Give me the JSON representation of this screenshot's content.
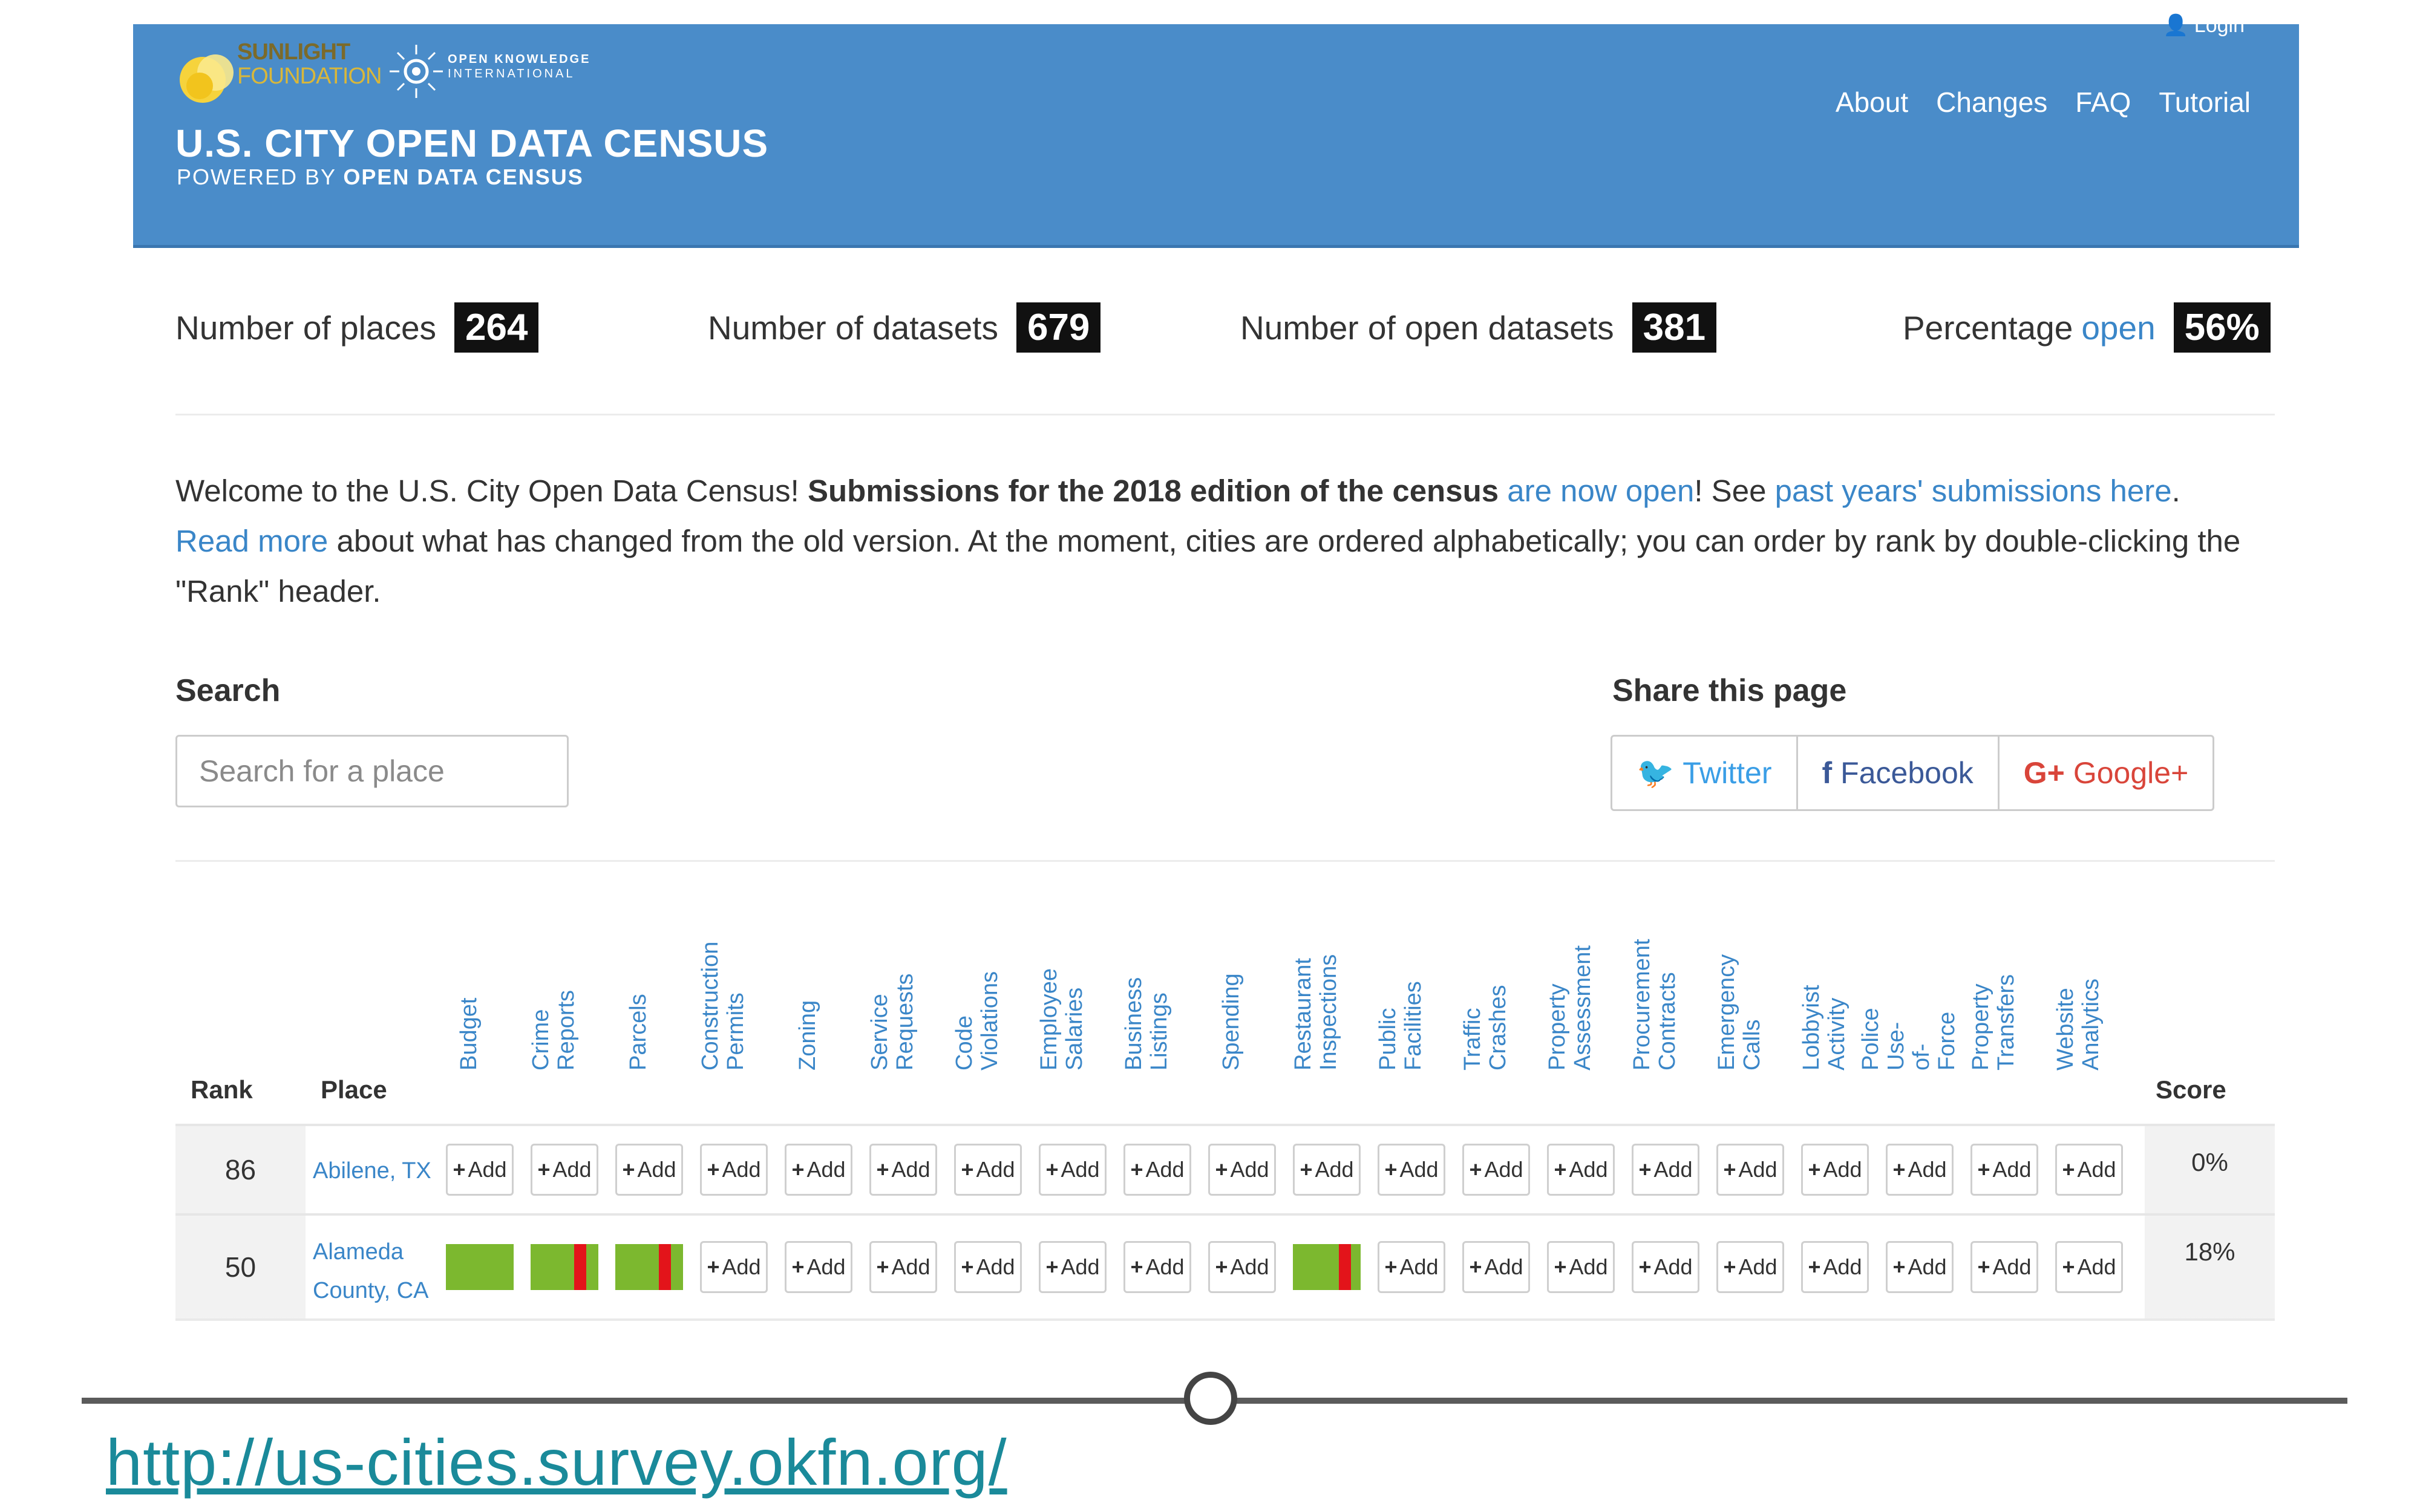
{
  "header": {
    "logo_sunlight_line1": "SUNLIGHT",
    "logo_sunlight_line2": "FOUNDATION",
    "logo_oki_line1": "OPEN KNOWLEDGE",
    "logo_oki_line2": "INTERNATIONAL",
    "title": "U.S. CITY OPEN DATA CENSUS",
    "subtitle_prefix": "POWERED BY",
    "subtitle_brand": "OPEN DATA CENSUS",
    "login": "Login",
    "nav": [
      "About",
      "Changes",
      "FAQ",
      "Tutorial"
    ],
    "color": "#4a8cc9"
  },
  "stats": [
    {
      "label": "Number of places",
      "value": "264"
    },
    {
      "label": "Number of datasets",
      "value": "679"
    },
    {
      "label": "Number of open datasets",
      "value": "381"
    },
    {
      "label": "Percentage",
      "label_link": "open",
      "value": "56%"
    }
  ],
  "welcome": {
    "t1": "Welcome to the U.S. City Open Data Census! ",
    "bold": "Submissions for the 2018 edition of the census ",
    "link1": "are now open",
    "t2": "! See ",
    "link2": "past years' submissions here",
    "t3": ".",
    "link3": "Read more",
    "t4": " about what has changed from the old version. At the moment, cities are ordered alphabetically; you can order by rank by double-clicking the \"Rank\" header."
  },
  "search": {
    "label": "Search",
    "placeholder": "Search for a place"
  },
  "share": {
    "label": "Share this page",
    "twitter": "Twitter",
    "facebook": "Facebook",
    "google": "Google+"
  },
  "table": {
    "rank_header": "Rank",
    "place_header": "Place",
    "score_header": "Score",
    "add_label": "Add",
    "columns": [
      [
        "Budget"
      ],
      [
        "Crime",
        "Reports"
      ],
      [
        "Parcels"
      ],
      [
        "Construction",
        "Permits"
      ],
      [
        "Zoning"
      ],
      [
        "Service",
        "Requests"
      ],
      [
        "Code",
        "Violations"
      ],
      [
        "Employee",
        "Salaries"
      ],
      [
        "Business",
        "Listings"
      ],
      [
        "Spending"
      ],
      [
        "Restaurant",
        "Inspections"
      ],
      [
        "Public",
        "Facilities"
      ],
      [
        "Traffic",
        "Crashes"
      ],
      [
        "Property",
        "Assessment"
      ],
      [
        "Procurement",
        "Contracts"
      ],
      [
        "Emergency",
        "Calls"
      ],
      [
        "Lobbyist",
        "Activity"
      ],
      [
        "Police",
        "Use-",
        "of-",
        "Force"
      ],
      [
        "Property",
        "Transfers"
      ],
      [
        "Website",
        "Analytics"
      ]
    ],
    "rows": [
      {
        "rank": "86",
        "place_line1": "Abilene, TX",
        "place_line2": "",
        "score": "0%",
        "cells": [
          "add",
          "add",
          "add",
          "add",
          "add",
          "add",
          "add",
          "add",
          "add",
          "add",
          "add",
          "add",
          "add",
          "add",
          "add",
          "add",
          "add",
          "add",
          "add",
          "add"
        ]
      },
      {
        "rank": "50",
        "place_line1": "Alameda",
        "place_line2": "County, CA",
        "score": "18%",
        "cells": [
          "green",
          "green-red",
          "green-red",
          "add",
          "add",
          "add",
          "add",
          "add",
          "add",
          "add",
          "green-red-right",
          "add",
          "add",
          "add",
          "add",
          "add",
          "add",
          "add",
          "add",
          "add"
        ]
      }
    ]
  },
  "footer": {
    "url": "http://us-cities.survey.okfn.org/"
  }
}
